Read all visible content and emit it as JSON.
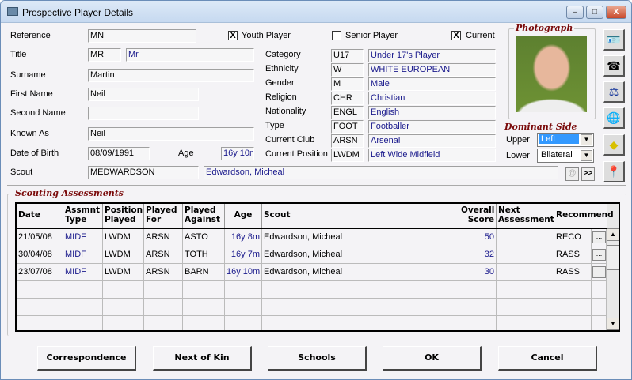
{
  "window": {
    "title": "Prospective Player Details",
    "minimize": "–",
    "maximize": "□",
    "close": "X"
  },
  "labels": {
    "reference": "Reference",
    "title": "Title",
    "surname": "Surname",
    "first_name": "First Name",
    "second_name": "Second Name",
    "known_as": "Known As",
    "dob": "Date of Birth",
    "age": "Age",
    "scout": "Scout",
    "category": "Category",
    "ethnicity": "Ethnicity",
    "gender": "Gender",
    "religion": "Religion",
    "nationality": "Nationality",
    "type": "Type",
    "current_club": "Current Club",
    "current_position": "Current Position"
  },
  "values": {
    "reference": "MN",
    "title_code": "MR",
    "title_desc": "Mr",
    "surname": "Martin",
    "first_name": "Neil",
    "second_name": "",
    "known_as": "Neil",
    "dob": "08/09/1991",
    "age": "16y 10m",
    "scout_code": "MEDWARDSON",
    "scout_name": "Edwardson, Micheal",
    "category_code": "U17",
    "category_desc": "Under 17's Player",
    "ethnicity_code": "W",
    "ethnicity_desc": "WHITE EUROPEAN",
    "gender_code": "M",
    "gender_desc": "Male",
    "religion_code": "CHR",
    "religion_desc": "Christian",
    "nationality_code": "ENGL",
    "nationality_desc": "English",
    "type_code": "FOOT",
    "type_desc": "Footballer",
    "club_code": "ARSN",
    "club_desc": "Arsenal",
    "position_code": "LWDM",
    "position_desc": "Left Wide Midfield"
  },
  "checkboxes": {
    "youth": {
      "label": "Youth Player",
      "checked": true
    },
    "senior": {
      "label": "Senior Player",
      "checked": false
    },
    "current": {
      "label": "Current",
      "checked": true
    }
  },
  "photo": {
    "label": "Photograph"
  },
  "dominant_side": {
    "label": "Dominant Side",
    "upper_label": "Upper",
    "upper_value": "Left",
    "lower_label": "Lower",
    "lower_value": "Bilateral"
  },
  "small_buttons": {
    "email": "@",
    "more": ">>"
  },
  "side_icons": [
    "player-card-icon",
    "contacts-icon",
    "scales-icon",
    "globe-document-icon",
    "note-icon",
    "pin-globe-icon"
  ],
  "assessments": {
    "label": "Scouting Assessments",
    "columns": [
      "Date",
      "Assmnt Type",
      "Position Played",
      "Played For",
      "Played Against",
      "Age",
      "Scout",
      "Overall Score",
      "Next Assessment",
      "Recommend"
    ],
    "rows": [
      [
        "21/05/08",
        "MIDF",
        "LWDM",
        "ARSN",
        "ASTO",
        "16y 8m",
        "Edwardson, Micheal",
        "50",
        "",
        "RECO"
      ],
      [
        "30/04/08",
        "MIDF",
        "LWDM",
        "ARSN",
        "TOTH",
        "16y 7m",
        "Edwardson, Micheal",
        "32",
        "",
        "RASS"
      ],
      [
        "23/07/08",
        "MIDF",
        "LWDM",
        "ARSN",
        "BARN",
        "16y 10m",
        "Edwardson, Micheal",
        "30",
        "",
        "RASS"
      ]
    ],
    "row_button": "..."
  },
  "buttons": {
    "correspondence": "Correspondence",
    "next_of_kin": "Next of Kin",
    "schools": "Schools",
    "ok": "OK",
    "cancel": "Cancel"
  }
}
